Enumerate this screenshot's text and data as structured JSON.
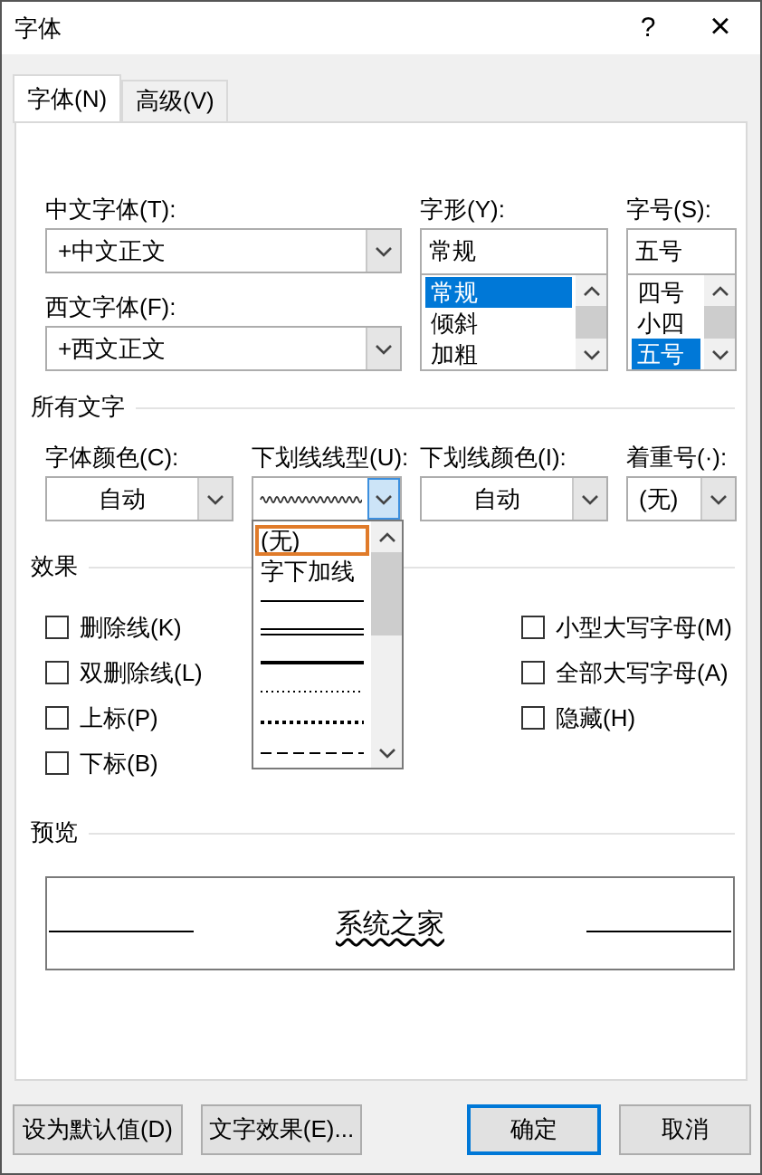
{
  "window": {
    "title": "字体",
    "help": "?",
    "close": "×"
  },
  "tabs": [
    {
      "label": "字体(N)",
      "selected": true
    },
    {
      "label": "高级(V)",
      "selected": false
    }
  ],
  "font": {
    "chinese_font": {
      "label": "中文字体(T):",
      "value": "+中文正文"
    },
    "western_font": {
      "label": "西文字体(F):",
      "value": "+西文正文"
    },
    "style": {
      "label": "字形(Y):",
      "value": "常规",
      "options": [
        {
          "label": "常规",
          "selected": true
        },
        {
          "label": "倾斜",
          "selected": false
        },
        {
          "label": "加粗",
          "selected": false
        }
      ]
    },
    "size": {
      "label": "字号(S):",
      "value": "五号",
      "options": [
        {
          "label": "四号",
          "selected": false
        },
        {
          "label": "小四",
          "selected": false
        },
        {
          "label": "五号",
          "selected": true
        }
      ]
    }
  },
  "all_text": {
    "heading": "所有文字",
    "font_color": {
      "label": "字体颜色(C):",
      "value": "自动"
    },
    "underline_style": {
      "label": "下划线线型(U):",
      "kind": "wavy",
      "expanded": true,
      "options": [
        {
          "kind": "text",
          "label": "(无)",
          "selected": true
        },
        {
          "kind": "text",
          "label": "字下加线",
          "selected": false
        },
        {
          "kind": "single",
          "selected": false
        },
        {
          "kind": "double",
          "selected": false
        },
        {
          "kind": "thick",
          "selected": false
        },
        {
          "kind": "dotted",
          "selected": false
        },
        {
          "kind": "dotted-heavy",
          "selected": false
        },
        {
          "kind": "dashed",
          "selected": false
        }
      ]
    },
    "underline_color": {
      "label": "下划线颜色(I):",
      "value": "自动"
    },
    "emphasis": {
      "label": "着重号(·):",
      "value": "(无)"
    }
  },
  "effects": {
    "heading": "效果",
    "left": [
      {
        "label": "删除线(K)",
        "checked": false
      },
      {
        "label": "双删除线(L)",
        "checked": false
      },
      {
        "label": "上标(P)",
        "checked": false
      },
      {
        "label": "下标(B)",
        "checked": false
      }
    ],
    "right": [
      {
        "label": "小型大写字母(M)",
        "checked": false
      },
      {
        "label": "全部大写字母(A)",
        "checked": false
      },
      {
        "label": "隐藏(H)",
        "checked": false
      }
    ]
  },
  "preview": {
    "heading": "预览",
    "text": "系统之家"
  },
  "buttons": [
    {
      "label": "设为默认值(D)",
      "default": false
    },
    {
      "label": "文字效果(E)...",
      "default": false
    },
    {
      "label": "确定",
      "default": true
    },
    {
      "label": "取消",
      "default": false
    }
  ]
}
